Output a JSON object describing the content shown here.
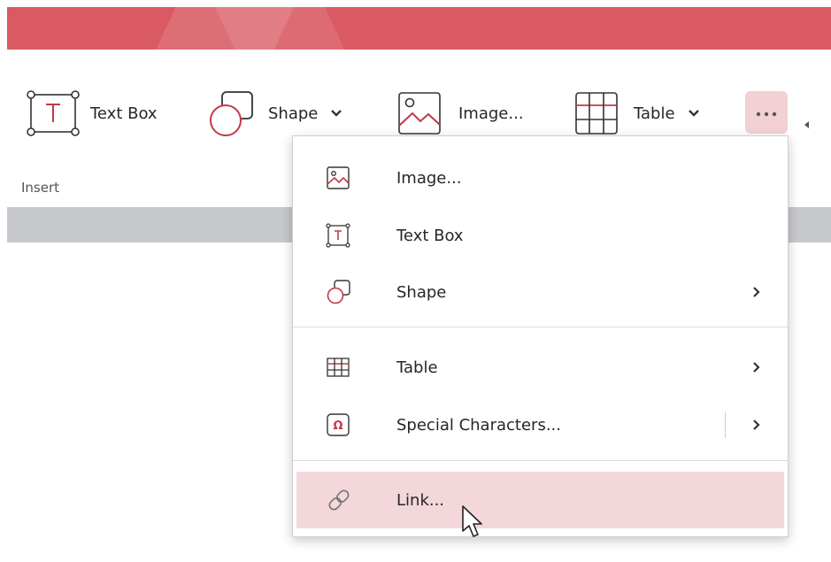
{
  "colors": {
    "titlebar": "#d95a63",
    "accent_icon": "#c23a46",
    "more_bg": "#f2d0d3",
    "hover_bg": "#f3d7da",
    "band": "#c6c8cb"
  },
  "ribbon": {
    "buttons": [
      {
        "label": "Text Box",
        "icon": "text-box-icon"
      },
      {
        "label": "Shape",
        "icon": "shape-icon"
      },
      {
        "label": "Image...",
        "icon": "image-icon"
      },
      {
        "label": "Table",
        "icon": "table-icon"
      }
    ],
    "more_icon": "more-options-icon",
    "group_label": "Insert"
  },
  "menu": {
    "items": [
      {
        "label": "Image...",
        "icon": "image-icon",
        "submenu": false
      },
      {
        "label": "Text Box",
        "icon": "text-box-icon",
        "submenu": false
      },
      {
        "label": "Shape",
        "icon": "shape-icon",
        "submenu": true
      },
      {
        "label": "Table",
        "icon": "table-icon",
        "submenu": true
      },
      {
        "label": "Special Characters...",
        "icon": "omega-icon",
        "submenu": true
      },
      {
        "label": "Link...",
        "icon": "link-icon",
        "submenu": false,
        "hovered": true
      }
    ]
  }
}
